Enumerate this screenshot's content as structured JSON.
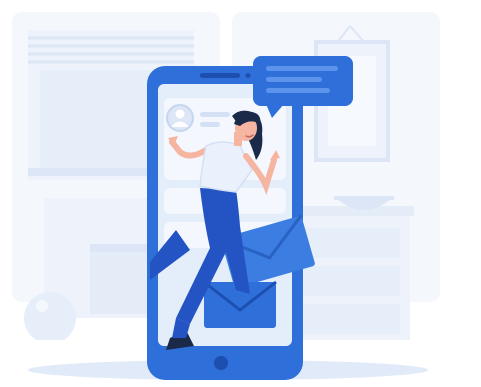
{
  "scene": {
    "subject": "woman-stepping-out-of-phone",
    "icons": [
      "chat-bubble-icon",
      "user-avatar-icon",
      "envelope-icon",
      "envelope-icon",
      "home-button-icon"
    ]
  },
  "colors": {
    "primary": "#2E6FD9",
    "primary_dark": "#1D4FB0",
    "screen": "#E4EEFB",
    "background_shapes": "#EEF3FB",
    "background_lines": "#DCE6F6",
    "skin": "#F6B5A0",
    "hair": "#1C2A4A",
    "shirt": "#EAF1FC",
    "jeans": "#2453C4",
    "floor_shadow": "#E1EAF8"
  }
}
